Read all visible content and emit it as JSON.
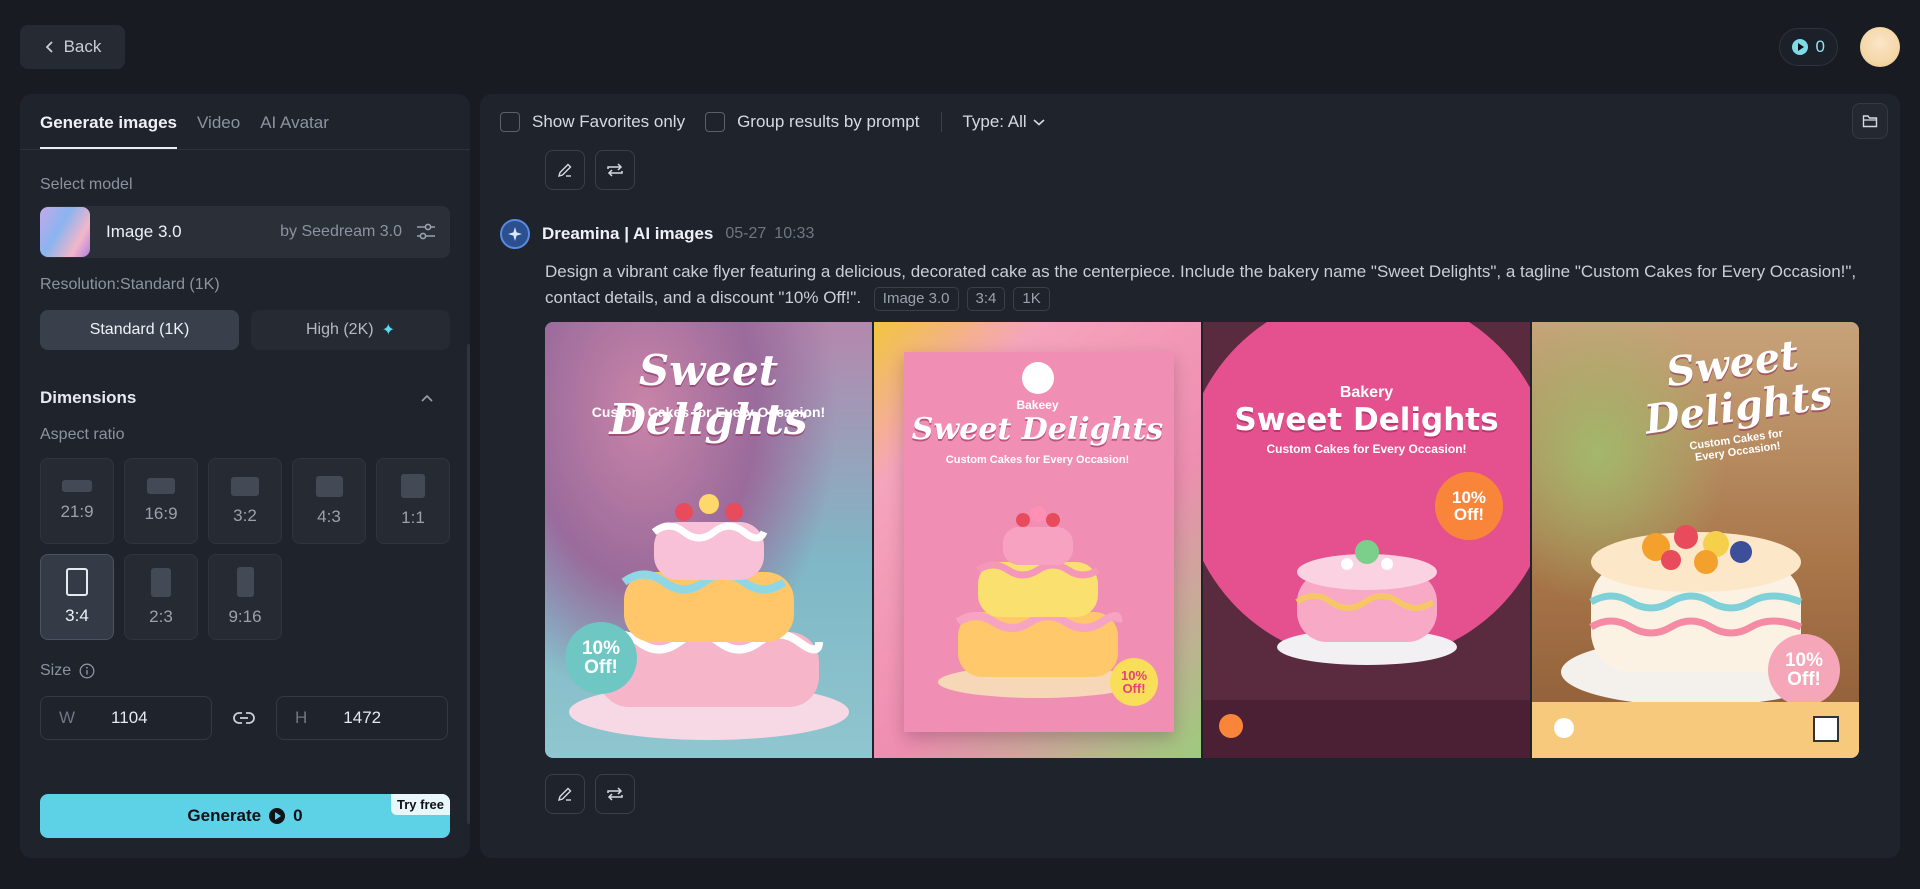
{
  "header": {
    "back_label": "Back",
    "credits": "0"
  },
  "tabs": [
    "Generate images",
    "Video",
    "AI Avatar"
  ],
  "model": {
    "label": "Select model",
    "name": "Image 3.0",
    "by": "by Seedream 3.0"
  },
  "resolution": {
    "label": "Resolution:Standard (1K)",
    "options": [
      "Standard (1K)",
      "High (2K)"
    ],
    "selected": "Standard (1K)"
  },
  "dimensions": {
    "title": "Dimensions",
    "aspect_label": "Aspect ratio",
    "ratios": [
      "21:9",
      "16:9",
      "3:2",
      "4:3",
      "1:1",
      "3:4",
      "2:3",
      "9:16"
    ],
    "selected": "3:4",
    "size_label": "Size",
    "w_label": "W",
    "w_value": "1104",
    "h_label": "H",
    "h_value": "1472"
  },
  "generate": {
    "label": "Generate",
    "cost": "0",
    "badge": "Try free"
  },
  "toolbar": {
    "favorites": "Show Favorites only",
    "group": "Group results by prompt",
    "type": "Type: All"
  },
  "message": {
    "author": "Dreamina | AI images",
    "date": "05-27",
    "time": "10:33",
    "prompt": "Design a vibrant cake flyer featuring a delicious, decorated cake as the centerpiece. Include the bakery name \"Sweet Delights\", a tagline \"Custom Cakes for Every Occasion!\", contact details, and a discount \"10% Off!\".",
    "tags": [
      "Image 3.0",
      "3:4",
      "1K"
    ]
  },
  "images": [
    {
      "title": "Sweet Delights",
      "tagline": "Custom Cakes for Every Occasion!",
      "discount": "10% Off!"
    },
    {
      "brand": "Bakeey",
      "title": "Sweet Delights",
      "tagline": "Custom Cakes for Every Occasion!",
      "discount": "10% Off!"
    },
    {
      "brand": "Bakery",
      "title": "Sweet Delights",
      "tagline": "Custom Cakes for Every Occasion!",
      "discount": "10% Off!"
    },
    {
      "title": "Sweet Delights",
      "tagline": "Custom Cakes for Every Occasion!",
      "discount": "10% Off!"
    }
  ]
}
